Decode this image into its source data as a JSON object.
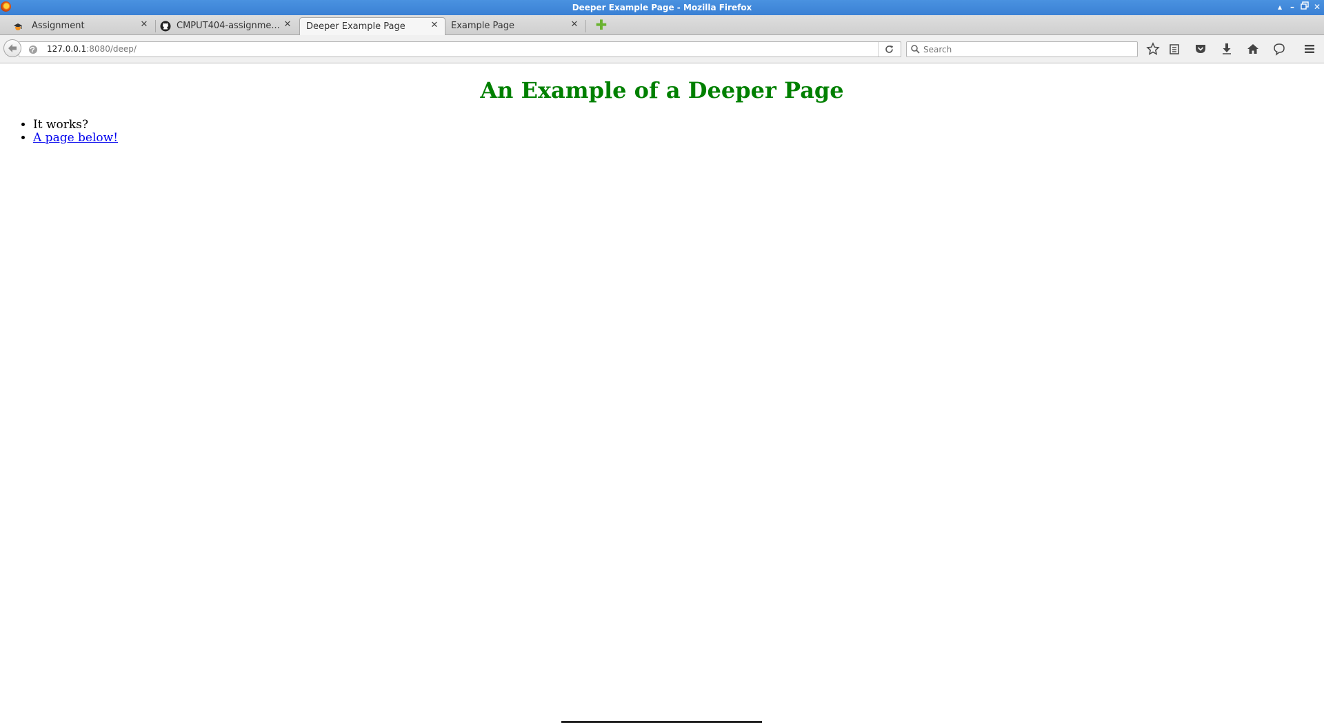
{
  "window": {
    "title": "Deeper Example Page - Mozilla Firefox"
  },
  "tabs": [
    {
      "label": "Assignment",
      "favicon": "moodle-icon",
      "selected": false
    },
    {
      "label": "CMPUT404-assignme...",
      "favicon": "github-icon",
      "selected": false
    },
    {
      "label": "Deeper Example Page",
      "favicon": "",
      "selected": true
    },
    {
      "label": "Example Page",
      "favicon": "",
      "selected": false
    }
  ],
  "navbar": {
    "url_host": "127.0.0.1",
    "url_rest": ":8080/deep/",
    "search_placeholder": "Search"
  },
  "page": {
    "heading": "An Example of a Deeper Page",
    "items": [
      {
        "text": "It works?"
      },
      {
        "link_text": "A page below!"
      }
    ]
  },
  "colors": {
    "titlebar": "#3a80d4",
    "heading": "#008000",
    "link": "#0000ee"
  }
}
